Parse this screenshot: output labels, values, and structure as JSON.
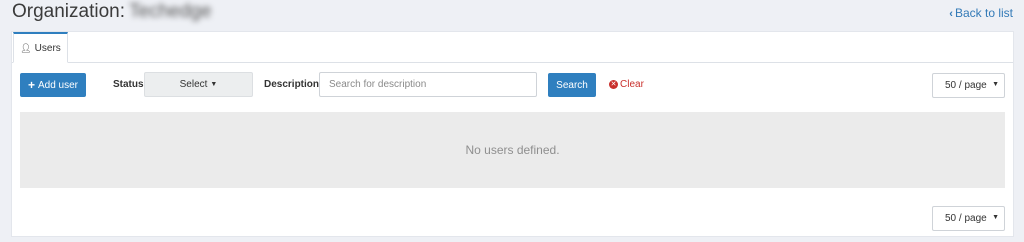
{
  "header": {
    "title_prefix": "Organization:",
    "org_name": "Techedge",
    "back_link": "Back to list"
  },
  "tabs": [
    {
      "label": "Users",
      "icon": "user-icon",
      "active": true
    }
  ],
  "toolbar": {
    "add_user_label": "Add user",
    "status_label": "Status",
    "status_select_value": "Select",
    "description_label": "Description",
    "description_placeholder": "Search for description",
    "description_value": "",
    "search_label": "Search",
    "clear_label": "Clear"
  },
  "pagination": {
    "top_value": "50 / page",
    "bottom_value": "50 / page"
  },
  "table": {
    "empty_message": "No users defined."
  },
  "colors": {
    "primary": "#2f7fbf",
    "danger": "#c9302c",
    "background": "#eef0f5"
  }
}
